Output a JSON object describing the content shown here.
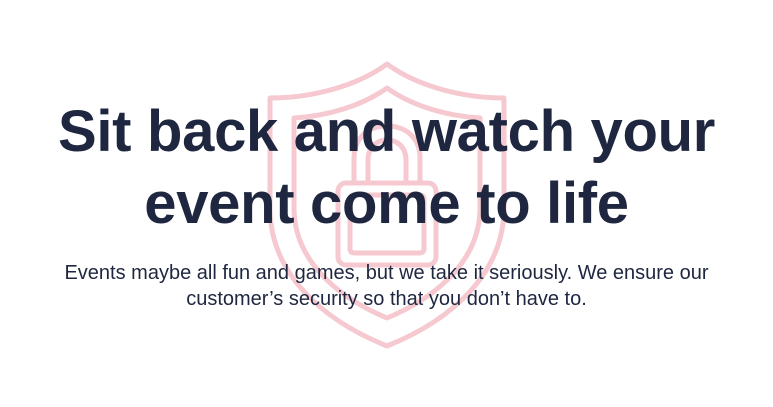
{
  "hero": {
    "headline_line1": "Sit back and watch your",
    "headline_line2": "event come to life",
    "subtitle_line1": "Events maybe all fun and games, but we take it seriously. We ensure our",
    "subtitle_line2": "customer’s security so that you don’t have to."
  },
  "background": {
    "icon": "shield-lock-icon",
    "icon_color": "#f5c9cf"
  },
  "colors": {
    "text": "#1f2740",
    "background": "#ffffff"
  }
}
